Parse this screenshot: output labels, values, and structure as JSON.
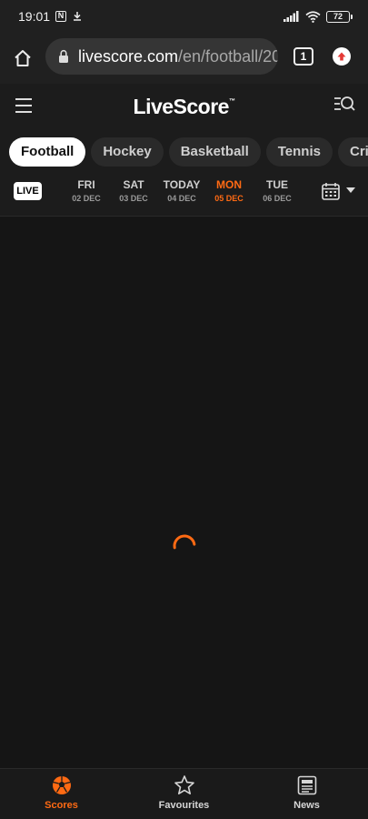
{
  "status_bar": {
    "time": "19:01",
    "nfc_glyph": "N",
    "battery": "72"
  },
  "browser": {
    "url_domain": "livescore.com",
    "url_path": "/en/football/20",
    "tab_count": "1"
  },
  "app": {
    "logo": "LiveScore",
    "logo_tm": "™"
  },
  "sport_tabs": [
    {
      "label": "Football",
      "active": true
    },
    {
      "label": "Hockey",
      "active": false
    },
    {
      "label": "Basketball",
      "active": false
    },
    {
      "label": "Tennis",
      "active": false
    },
    {
      "label": "Cricke",
      "active": false
    }
  ],
  "date_bar": {
    "live_label": "LIVE",
    "dates": [
      {
        "day": "FRI",
        "date": "02 DEC",
        "selected": false
      },
      {
        "day": "SAT",
        "date": "03 DEC",
        "selected": false
      },
      {
        "day": "TODAY",
        "date": "04 DEC",
        "selected": false
      },
      {
        "day": "MON",
        "date": "05 DEC",
        "selected": true
      },
      {
        "day": "TUE",
        "date": "06 DEC",
        "selected": false
      }
    ]
  },
  "bottom_nav": {
    "items": [
      {
        "label": "Scores",
        "icon": "soccer-ball-icon",
        "active": true
      },
      {
        "label": "Favourites",
        "icon": "star-icon",
        "active": false
      },
      {
        "label": "News",
        "icon": "news-icon",
        "active": false
      }
    ]
  },
  "colors": {
    "accent": "#ff6a13",
    "background": "#151515",
    "header": "#1c1c1c"
  }
}
